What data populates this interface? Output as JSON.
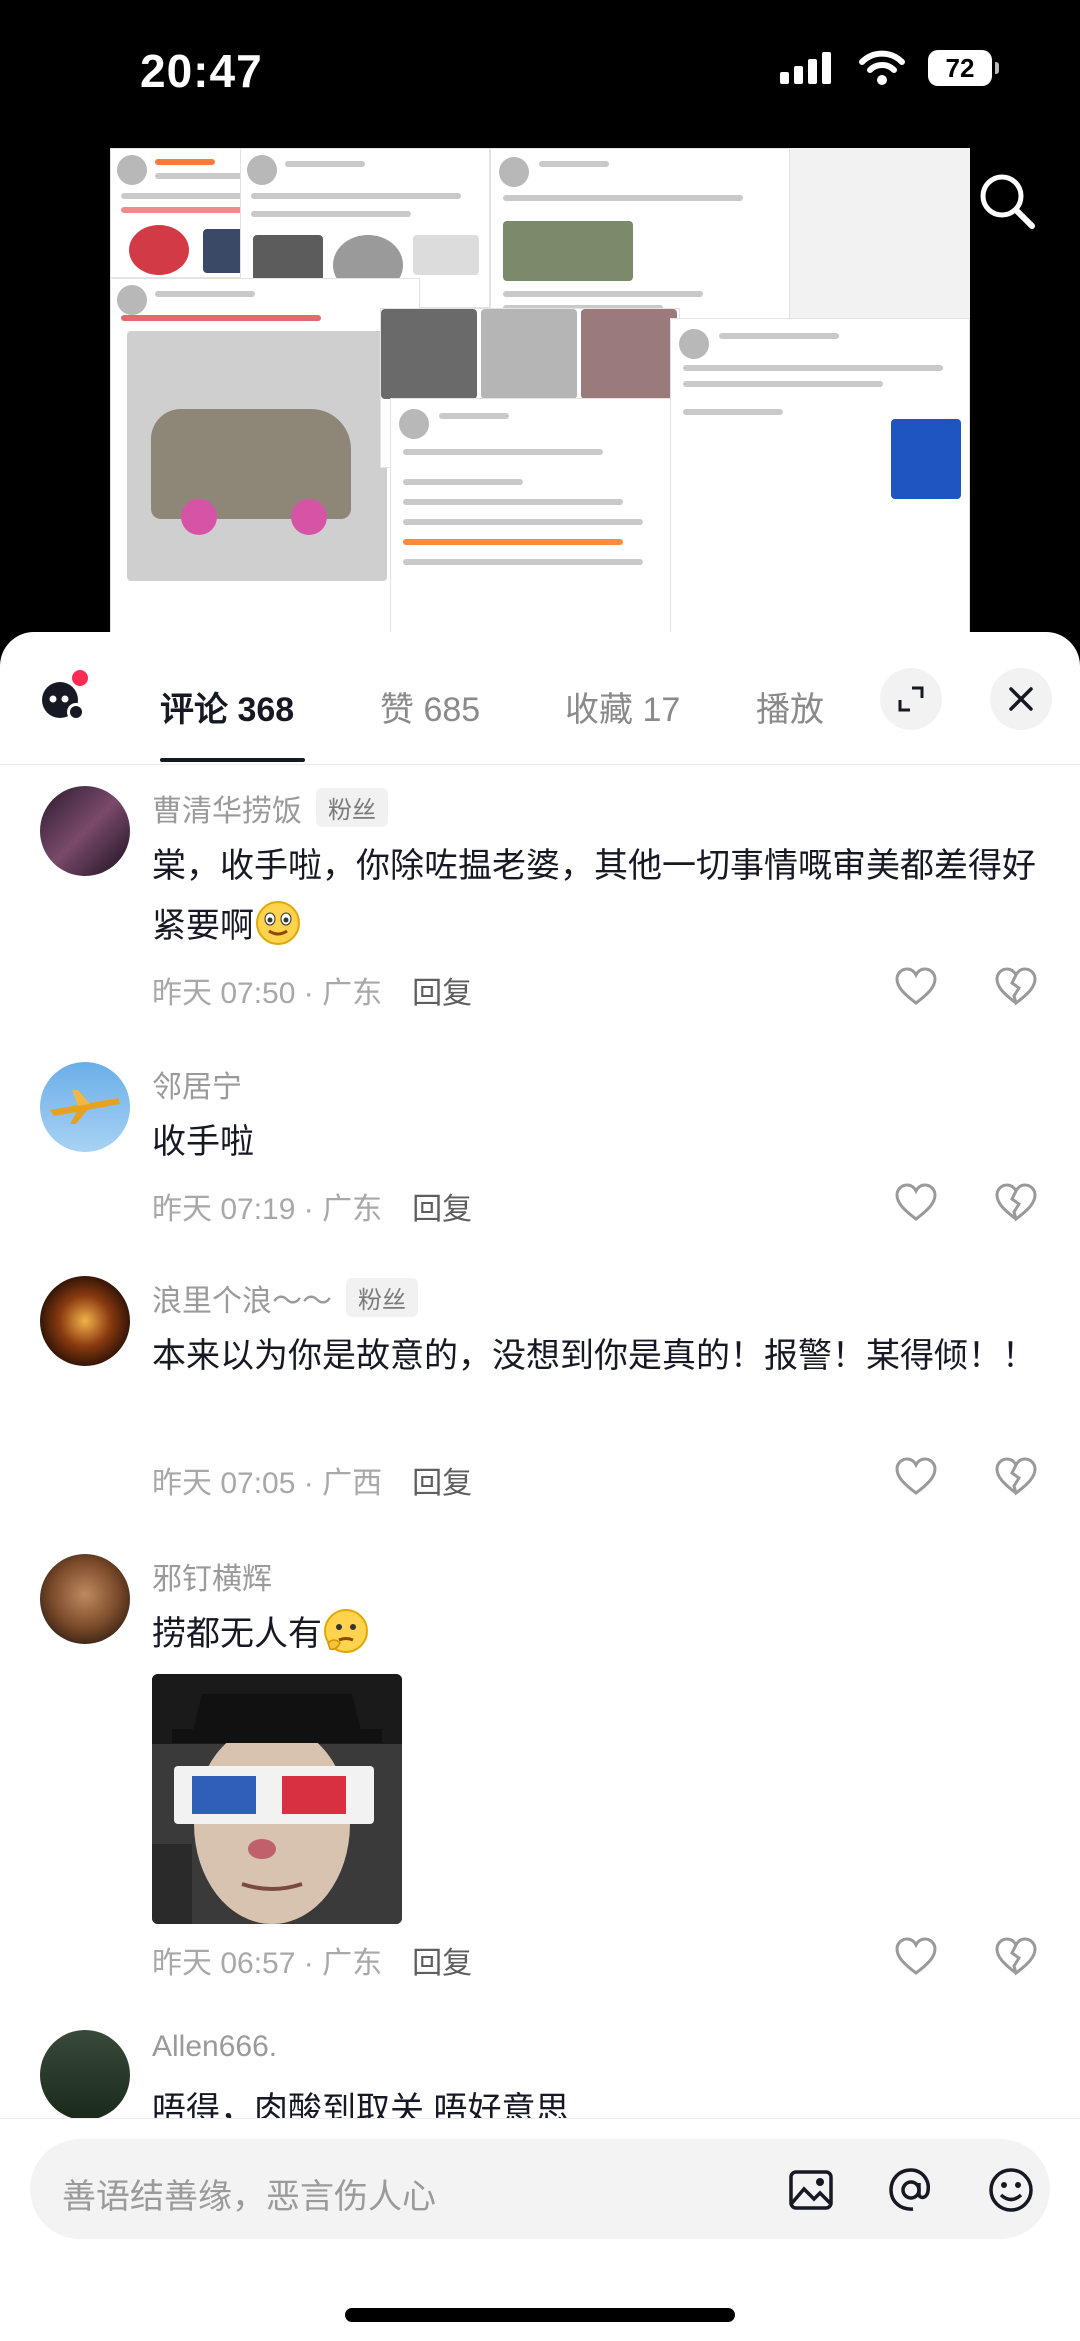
{
  "status": {
    "time": "20:47",
    "battery": "72"
  },
  "tabs": {
    "comments": "评论 368",
    "likes": "赞 685",
    "favorites": "收藏 17",
    "plays": "播放"
  },
  "comments": [
    {
      "name": "曹清华捞饭",
      "badge": "粉丝",
      "text": "棠，收手啦，你除咗揾老婆，其他一切事情嘅审美都差得好紧要啊",
      "time": "昨天 07:50 · 广东",
      "reply": "回复"
    },
    {
      "name": "邻居宁",
      "text": "收手啦",
      "time": "昨天 07:19 · 广东",
      "reply": "回复"
    },
    {
      "name": "浪里个浪～～",
      "badge": "粉丝",
      "text": "本来以为你是故意的，没想到你是真的！报警！某得倾！！",
      "time": "昨天 07:05 · 广西",
      "reply": "回复"
    },
    {
      "name": "邪钉横辉",
      "text": "捞都无人有",
      "time": "昨天 06:57 · 广东",
      "reply": "回复"
    },
    {
      "name": "Allen666.",
      "text": "唔得，肉酸到取关 唔好意思"
    }
  ],
  "input": {
    "placeholder": "善语结善缘，恶言伤人心"
  },
  "colors": {
    "accent": "#fe2c55",
    "text": "#161823",
    "muted": "#9a9a9a"
  }
}
